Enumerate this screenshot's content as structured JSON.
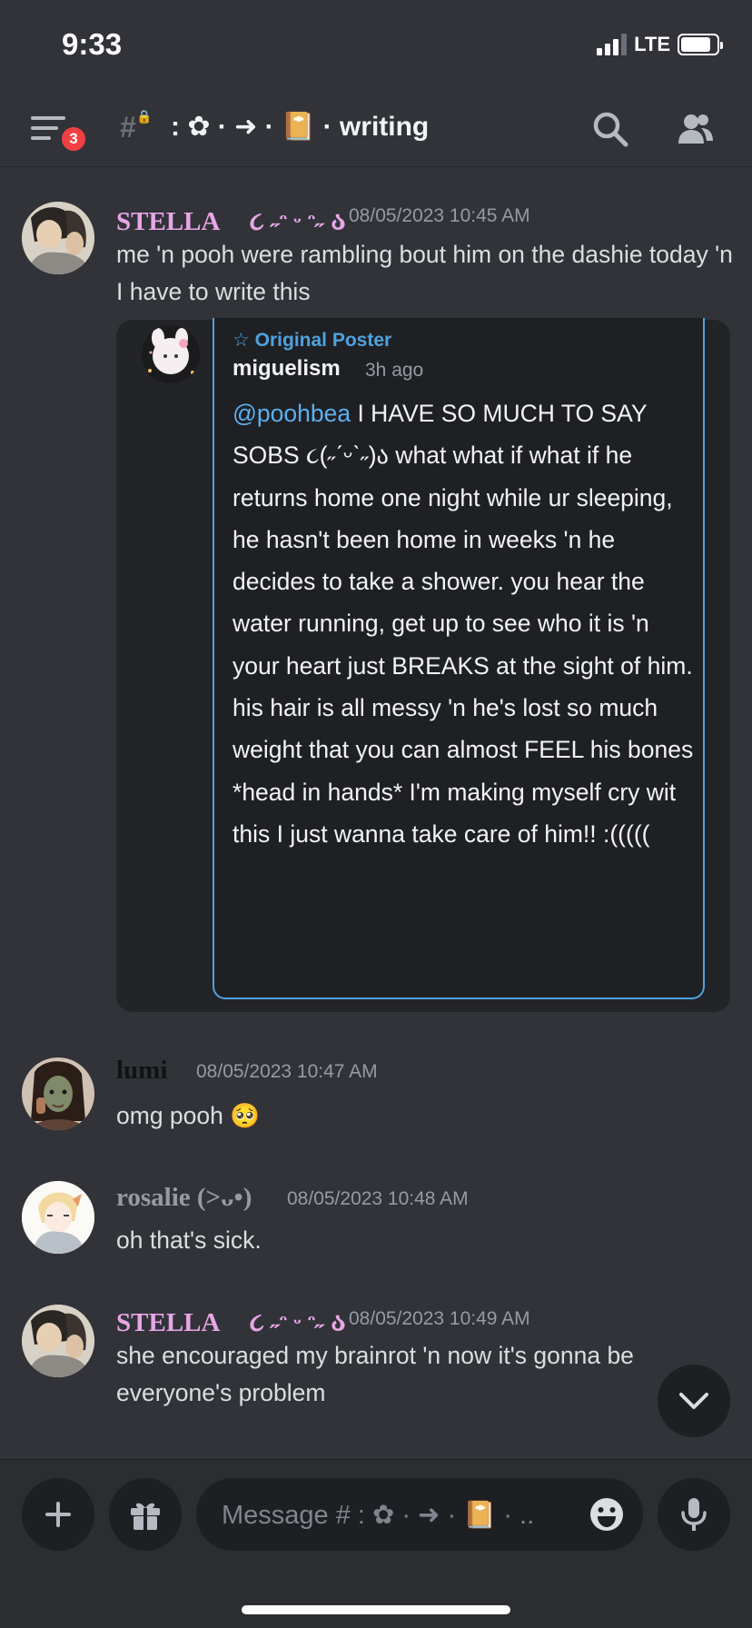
{
  "status_bar": {
    "time": "9:33",
    "network": "LTE",
    "signal_bars": 3,
    "battery_level": 0.85
  },
  "header": {
    "unread_count": "3",
    "channel_name": ": ✿ · ➜ · 📔 · writing"
  },
  "colors": {
    "background": "#313338",
    "stella_name": "#e8a6e6",
    "lumi_name": "#111214",
    "rosalie_name": "#949ba4",
    "original_poster": "#4fa3df",
    "mention": "#5ab0f0",
    "notification_badge": "#f23f43"
  },
  "messages": [
    {
      "author": "STELLA ㅤ૮ ˶ᵔ ᵕ ᵔ˶ აㅤ",
      "timestamp": "08/05/2023 10:45 AM",
      "text": "me 'n pooh were rambling bout him on the dashie today 'n I have to write this",
      "avatar": "stella-avatar"
    },
    {
      "author": "lumi",
      "timestamp": "08/05/2023 10:47 AM",
      "text": "omg pooh 🥺",
      "avatar": "lumi-avatar"
    },
    {
      "author": "rosalie (>ᴗ•)",
      "timestamp": "08/05/2023 10:48 AM",
      "text": "oh that's sick.",
      "avatar": "rosalie-avatar"
    },
    {
      "author": "STELLA ㅤ૮ ˶ᵔ ᵕ ᵔ˶ აㅤ",
      "timestamp": "08/05/2023 10:49 AM",
      "text": "she encouraged my brainrot 'n now it's gonna be everyone's problem",
      "avatar": "stella-avatar"
    }
  ],
  "embed": {
    "label": "Original Poster",
    "username": "miguelism",
    "ago": "3h ago",
    "mention": "@poohbea",
    "text": " I HAVE SO MUCH TO SAY SOBS ૮(˶ˊᵕˋ˶)ა what what if what if he returns home one night while ur sleeping, he hasn't been home in weeks 'n he decides to take a shower. you hear the water running, get up to see who it is 'n your heart just BREAKS at the sight of him. his hair is all messy 'n he's lost so much weight that you can almost FEEL his bones *head in hands* I'm making myself cry wit this I just wanna take care of him!! :((((("
  },
  "composer": {
    "placeholder": "Message # : ✿ · ➜ · 📔 · .."
  }
}
